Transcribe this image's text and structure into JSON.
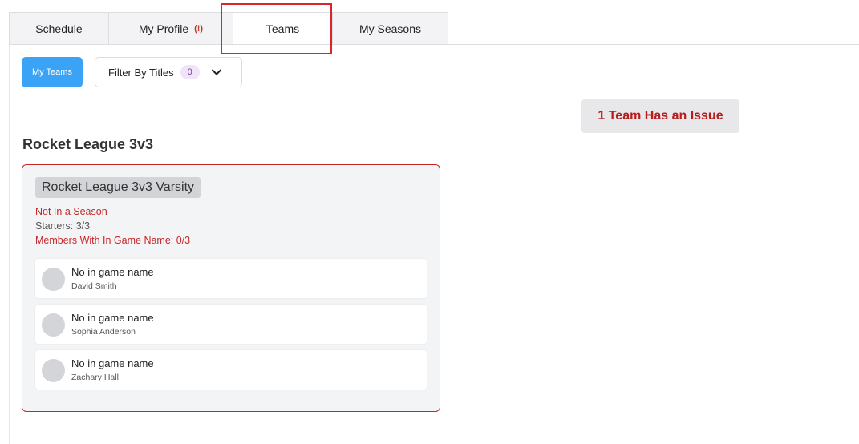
{
  "tabs": [
    {
      "label": "Schedule",
      "active": false
    },
    {
      "label": "My Profile",
      "active": false,
      "alert": "(!)"
    },
    {
      "label": "Teams",
      "active": true
    },
    {
      "label": "My Seasons",
      "active": false
    }
  ],
  "filters": {
    "my_teams_label": "My Teams",
    "filter_titles_label": "Filter By Titles",
    "filter_titles_count": "0",
    "dropdown_icon": "chevron-down-icon"
  },
  "issue_badge": "1 Team Has an Issue",
  "section_title": "Rocket League 3v3",
  "team": {
    "name": "Rocket League 3v3 Varsity",
    "season_status": "Not In a Season",
    "starters": "Starters: 3/3",
    "members_ign": "Members With In Game Name: 0/3",
    "members": [
      {
        "ign": "No in game name",
        "name": "David Smith"
      },
      {
        "ign": "No in game name",
        "name": "Sophia Anderson"
      },
      {
        "ign": "No in game name",
        "name": "Zachary Hall"
      }
    ]
  },
  "colors": {
    "accent_blue": "#3ba3f5",
    "error_red": "#c62828",
    "highlight_red": "#d9262c"
  }
}
